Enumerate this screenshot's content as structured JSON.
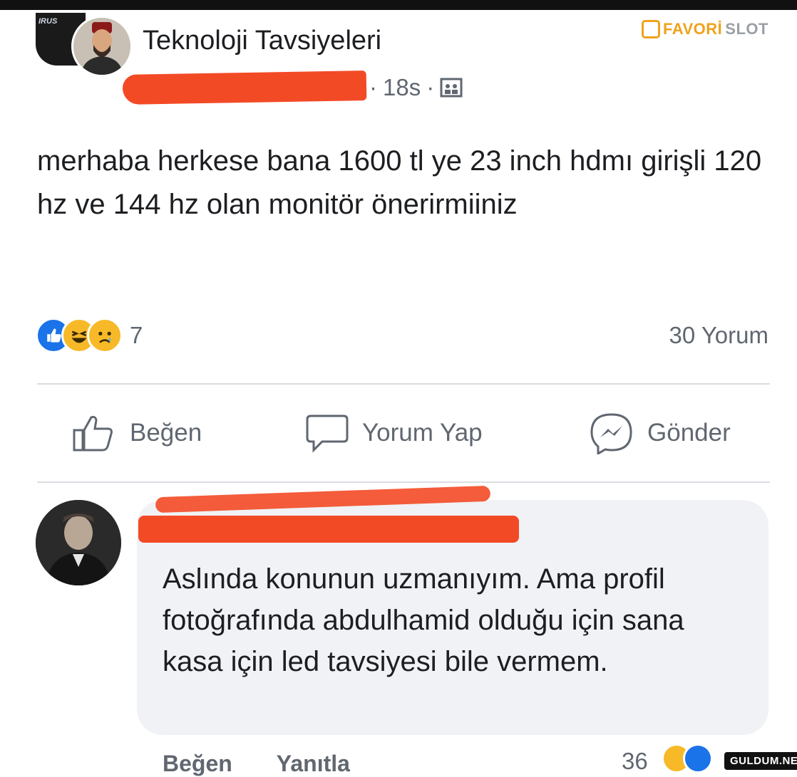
{
  "post": {
    "group_name": "Teknoloji Tavsiyeleri",
    "time": "18s",
    "separator": "·",
    "text": "merhaba herkese bana 1600 tl ye 23 inch hdmı girişli 120 hz ve 144 hz olan monitör önerirmiiniz",
    "reaction_count": "7",
    "comment_count": "30 Yorum"
  },
  "actions": {
    "like": "Beğen",
    "comment": "Yorum Yap",
    "send": "Gönder"
  },
  "comment": {
    "text": "Aslında konunun uzmanıyım. Ama profil fotoğrafında abdulhamid olduğu için sana kasa için led tavsiyesi bile vermem.",
    "like_label": "Beğen",
    "reply_label": "Yanıtla",
    "reaction_count": "36"
  },
  "branding": {
    "logo_text_1": "FAVORİ",
    "logo_text_2": "SLOT",
    "thumb_tag": "IRUS",
    "watermark": "GULDUM.NET"
  },
  "colors": {
    "redaction": "#f34a26",
    "like_blue": "#1a73e8",
    "emoji_yellow": "#f7b928",
    "brand_orange": "#f0a21c"
  }
}
